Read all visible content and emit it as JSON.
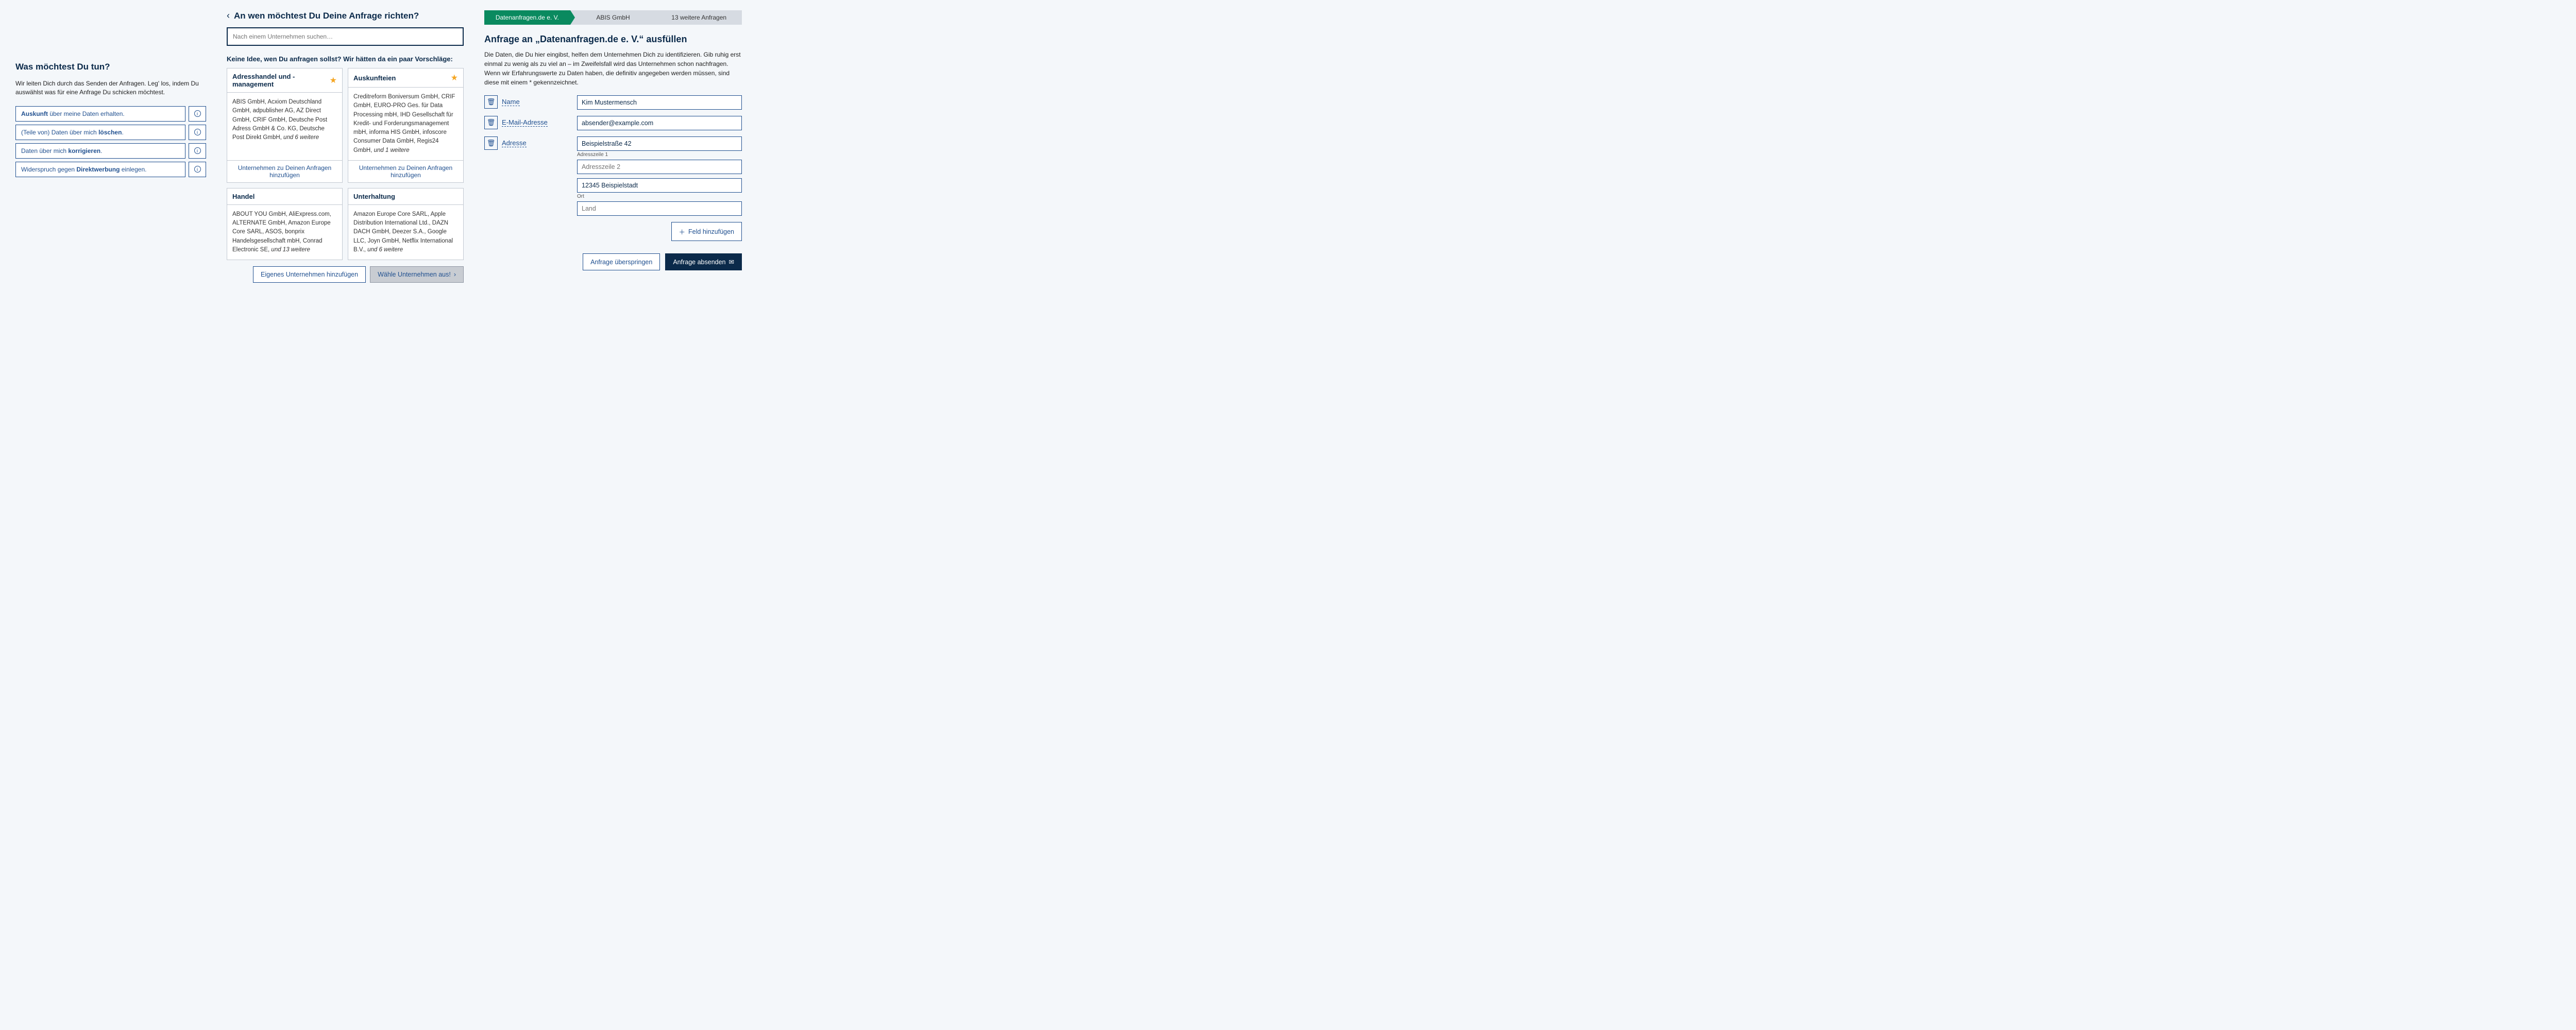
{
  "left": {
    "title": "Was möchtest Du tun?",
    "subtitle": "Wir leiten Dich durch das Senden der Anfragen. Leg' los, indem Du auswählst was für eine Anfrage Du schicken möchtest.",
    "actions": [
      {
        "pre": "Auskunft",
        "post": " über meine Daten erhalten."
      },
      {
        "pre": "",
        "mid": "(Teile von) Daten über mich ",
        "bold": "löschen",
        "post": "."
      },
      {
        "pre": "",
        "mid": "Daten über mich ",
        "bold": "korrigieren",
        "post": "."
      },
      {
        "pre": "",
        "mid": "Widerspruch gegen ",
        "bold": "Direktwerbung",
        "post": " einlegen."
      }
    ]
  },
  "mid": {
    "heading": "An wen möchtest Du Deine Anfrage richten?",
    "search_placeholder": "Nach einem Unternehmen suchen…",
    "suggest_heading": "Keine Idee, wen Du anfragen sollst? Wir hätten da ein paar Vorschläge:",
    "cards": [
      {
        "title": "Adresshandel und -management",
        "starred": true,
        "body": "ABIS GmbH, Acxiom Deutschland GmbH, adpublisher AG, AZ Direct GmbH, CRIF GmbH, Deutsche Post Adress GmbH & Co. KG, Deutsche Post Direkt GmbH,",
        "more": " und 6 weitere",
        "cta": "Unternehmen zu Deinen Anfragen hinzufügen"
      },
      {
        "title": "Auskunfteien",
        "starred": true,
        "body": "Creditreform Boniversum GmbH, CRIF GmbH, EURO-PRO Ges. für Data Processing mbH, IHD Gesellschaft für Kredit- und Forderungsmanagement mbH, informa HIS GmbH, infoscore Consumer Data GmbH, Regis24 GmbH,",
        "more": " und 1 weitere",
        "cta": "Unternehmen zu Deinen Anfragen hinzufügen"
      },
      {
        "title": "Handel",
        "starred": false,
        "body": "ABOUT YOU GmbH, AliExpress.com, ALTERNATE GmbH, Amazon Europe Core SARL, ASOS, bonprix Handelsgesellschaft mbH, Conrad Electronic SE,",
        "more": " und 13 weitere",
        "cta": ""
      },
      {
        "title": "Unterhaltung",
        "starred": false,
        "body": "Amazon Europe Core SARL, Apple Distribution International Ltd., DAZN DACH GmbH, Deezer S.A., Google LLC, Joyn GmbH, Netflix International B.V.,",
        "more": " und 6 weitere",
        "cta": ""
      }
    ],
    "own_company": "Eigenes Unternehmen hinzufügen",
    "choose_companies": "Wähle Unternehmen aus!"
  },
  "right": {
    "steps": [
      "Datenanfragen.de e. V.",
      "ABIS GmbH",
      "13 weitere Anfragen"
    ],
    "title": "Anfrage an „Datenanfragen.de e. V.“ ausfüllen",
    "desc": "Die Daten, die Du hier eingibst, helfen dem Unternehmen Dich zu identifizieren. Gib ruhig erst einmal zu wenig als zu viel an – im Zweifelsfall wird das Unternehmen schon nachfragen.\nWenn wir Erfahrungswerte zu Daten haben, die definitiv angegeben werden müssen, sind diese mit einem * gekennzeichnet.",
    "fields": {
      "name": {
        "label": "Name",
        "value": "Kim Mustermensch"
      },
      "email": {
        "label": "E-Mail-Adresse",
        "value": "absender@example.com"
      },
      "address": {
        "label": "Adresse",
        "line1": "Beispielstraße 42",
        "line1_label": "Adresszeile 1",
        "line2_placeholder": "Adresszeile 2",
        "city": "12345 Beispielstadt",
        "city_label": "Ort",
        "country_placeholder": "Land"
      }
    },
    "add_field": "Feld hinzufügen",
    "skip": "Anfrage überspringen",
    "send": "Anfrage absenden"
  }
}
